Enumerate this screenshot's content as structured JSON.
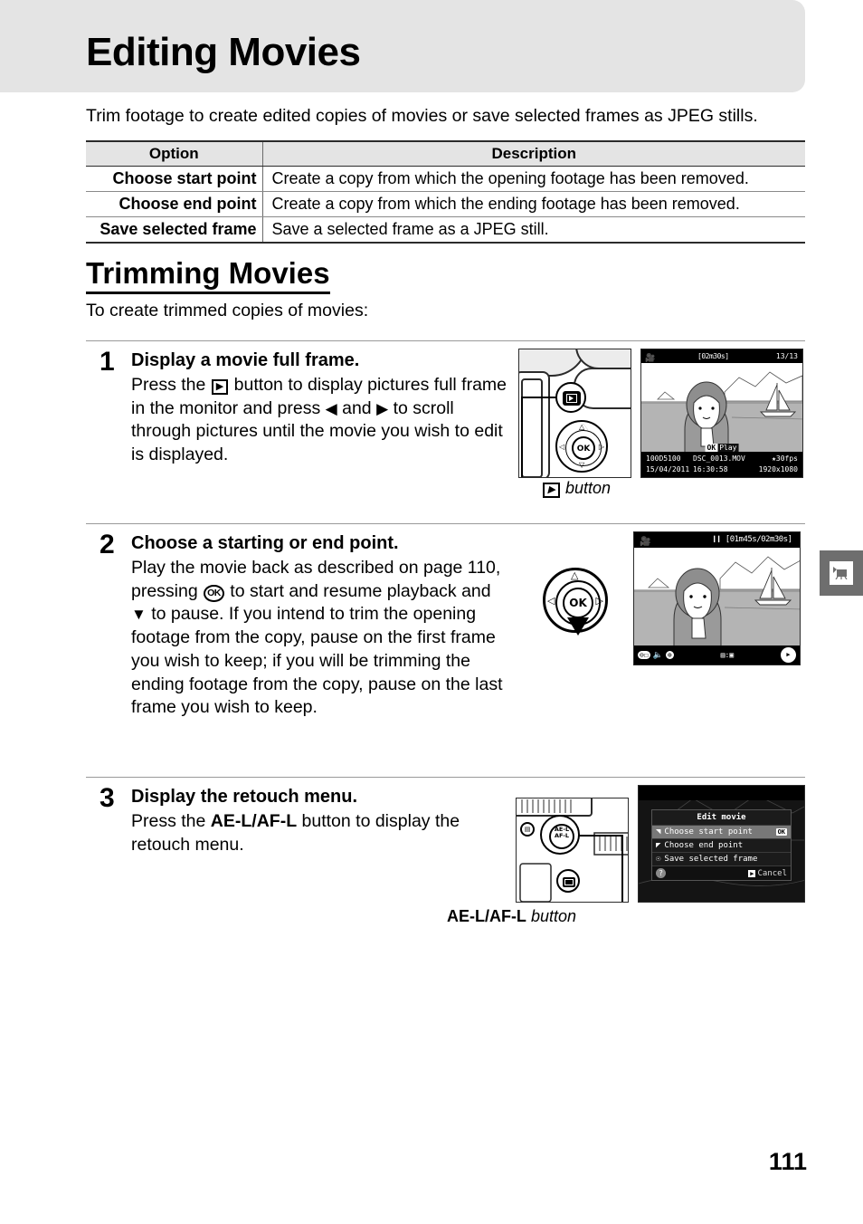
{
  "page": {
    "title": "Editing Movies",
    "intro": "Trim footage to create edited copies of movies or save selected frames as JPEG stills.",
    "folio": "111",
    "side_tab_icon": "movie-camera-icon",
    "header_bg": "#e4e4e4",
    "side_tab_bg": "#6e6e6e"
  },
  "option_table": {
    "headers": [
      "Option",
      "Description"
    ],
    "rows": [
      {
        "option": "Choose start point",
        "description": "Create a copy from which the opening footage has been removed."
      },
      {
        "option": "Choose end point",
        "description": "Create a copy from which the ending footage has been removed."
      },
      {
        "option": "Save selected frame",
        "description": "Save a selected frame as a JPEG still."
      }
    ]
  },
  "section": {
    "heading": "Trimming Movies",
    "subtitle": "To create trimmed copies of movies:"
  },
  "steps": [
    {
      "number": "1",
      "title": "Display a movie full frame.",
      "text_a": "Press the ",
      "text_b": " button to display pictures full frame in the monitor and press ",
      "text_c": " and ",
      "text_d": " to scroll through pictures until the movie you wish to edit is displayed.",
      "caption_label": "button",
      "caption_icon": "playback-icon"
    },
    {
      "number": "2",
      "title": "Choose a starting or end point.",
      "text_a": "Play the movie back as described on page 110, pressing ",
      "text_b": " to start and resume playback and ",
      "text_c": " to pause.  If you intend to trim the opening footage from the copy, pause on the first frame you wish to keep; if you will be trimming the ending footage from the copy, pause on the last frame you wish to keep."
    },
    {
      "number": "3",
      "title": "Display the retouch menu.",
      "text_a": "Press the ",
      "button_name": "AE-L/AF-L",
      "text_b": " button to display the retouch menu.",
      "caption_button": "AE-L/AF-L",
      "caption_label": "button"
    }
  ],
  "lcd_fullframe": {
    "duration": "02m30s",
    "frame_counter": "13/13",
    "play_badge": "OK",
    "play_label": "Play",
    "folder": "100D5100",
    "filename": "DSC_0013.MOV",
    "framerate": "30fps",
    "date": "15/04/2011",
    "time": "16:30:58",
    "resolution": "1920x1080"
  },
  "lcd_playback": {
    "status_icon": "pause-icon",
    "elapsed": "01m45s",
    "total": "02m30s",
    "separator": "/",
    "icon_zoom_out": "zoom-out-icon",
    "icon_volume": "volume-icon",
    "icon_zoom_in": "zoom-in-icon",
    "icon_trim": "trim-icon",
    "icon_navpad": "multi-selector-icon"
  },
  "lcd_menu": {
    "title": "Edit movie",
    "items": [
      {
        "label": "Choose start point",
        "icon": "start-point-icon",
        "selected": true,
        "badge": "OK"
      },
      {
        "label": "Choose end point",
        "icon": "end-point-icon",
        "selected": false,
        "badge": ""
      },
      {
        "label": "Save selected frame",
        "icon": "save-frame-icon",
        "selected": false,
        "badge": ""
      }
    ],
    "help_icon": "help-icon",
    "cancel_label": "Cancel",
    "cancel_icon": "playback-icon"
  }
}
